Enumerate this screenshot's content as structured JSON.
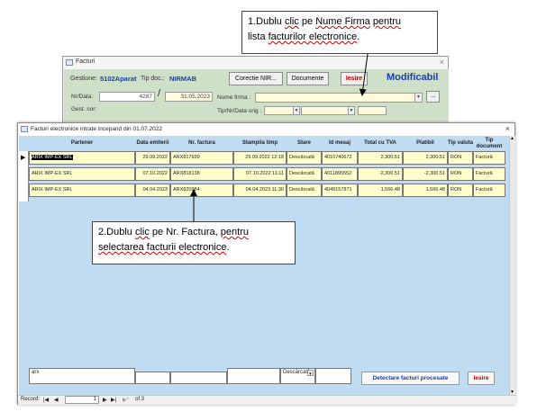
{
  "back_form": {
    "title": "Facturi",
    "gestiune_label": "Gestiune:",
    "gestiune_value": "5102Aparat",
    "tip_doc_label": "Tip doc.:",
    "tip_doc_value": "NIRMAB",
    "corectie_button": "Corectie NIR...",
    "documente_button": "Documente",
    "iesire_button": "Iesire",
    "modificabil_label": "Modificabil",
    "nr_data_label": "Nr/Data:",
    "nr_value": "4287",
    "slash": "/",
    "date_value": "31.05.2023",
    "gest_cor_label": "Gest. cor:",
    "nume_firma_label": "Nume firma :",
    "ellipsis_button": "...",
    "tip_nr_data_label": "Tip/Nr/Data orig :"
  },
  "callout_1": {
    "line1_start": "1.Dublu ",
    "line1_wavy": "clic",
    "line1_mid": " pe ",
    "line1_wavy2": "Nume Firma",
    "line1_mid2": " ",
    "line1_wavy3": "pentru",
    "line2_start": "lista ",
    "line2_wavy": "facturilor electronice",
    "line2_end": "."
  },
  "callout_2": {
    "line1_start": "2.Dublu ",
    "line1_wavy": "clic",
    "line1_mid": " pe Nr. Factura, ",
    "line1_wavy2": "pentru",
    "line2_wavy": "selectarea facturii electronice",
    "line2_end": "."
  },
  "front_form": {
    "title": "Facturi electronice intrate incepand din 01.07.2022",
    "columns": [
      "Partener",
      "Data emiterii",
      "Nr. factura",
      "Stampila timp",
      "Stare",
      "Id mesaj",
      "Total cu TVA",
      "Platibil",
      "Tip valuta",
      "Tip document"
    ],
    "rows": [
      {
        "partener": "ARIX IMP-EX SRL",
        "data": "29.09.2022",
        "nr": "ARX817939",
        "stampila": "29.09.2022 12:18",
        "stare": "Descărcată",
        "id": "4010740672",
        "total": "2,300.51",
        "platibil": "2,300.51",
        "valuta": "RON",
        "tipdoc": "Factură"
      },
      {
        "partener": "ARIX IMP-EX SRL",
        "data": "07.10.2022",
        "nr": "ARX818138",
        "stampila": "07.10.2022 11:11",
        "stare": "Descărcată",
        "id": "4011895552",
        "total": "-2,300.51",
        "platibil": "-2,300.51",
        "valuta": "RON",
        "tipdoc": "Factură"
      },
      {
        "partener": "ARIX IMP-EX SRL",
        "data": "04.04.2023",
        "nr": "ARX820984",
        "stampila": "04.04.2023 11:30",
        "stare": "Descărcată",
        "id": "4049157871",
        "total": "1,566.48",
        "platibil": "1,566.48",
        "valuta": "RON",
        "tipdoc": "Factură"
      }
    ],
    "filter_partener": "arx",
    "filter_stare": "Descărcată",
    "detect_button": "Detectare facturi procesate",
    "iesire_button": "Iesire",
    "record_label": "Record:",
    "record_current": "1",
    "record_of": "of 3"
  },
  "colors": {
    "back_body": "#cfe0c8",
    "grid_bg": "#bfdcf3",
    "row_bg": "#ffffcc",
    "accent_blue": "#1a3fa8",
    "iesire_red": "#c00000"
  }
}
